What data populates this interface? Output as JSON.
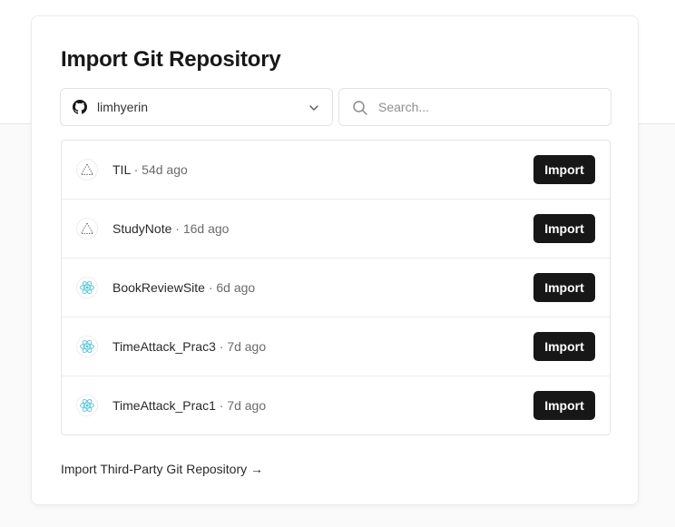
{
  "modal": {
    "title": "Import Git Repository",
    "account": {
      "name": "limhyerin",
      "icon": "github-icon"
    },
    "search": {
      "placeholder": "Search..."
    },
    "repos": [
      {
        "name": "TIL",
        "separator": " · ",
        "age": "54d ago",
        "icon": "vercel-triangle-icon",
        "button": "Import"
      },
      {
        "name": "StudyNote",
        "separator": " · ",
        "age": "16d ago",
        "icon": "vercel-triangle-icon",
        "button": "Import"
      },
      {
        "name": "BookReviewSite",
        "separator": " · ",
        "age": "6d ago",
        "icon": "react-icon",
        "button": "Import"
      },
      {
        "name": "TimeAttack_Prac3",
        "separator": " · ",
        "age": "7d ago",
        "icon": "react-icon",
        "button": "Import"
      },
      {
        "name": "TimeAttack_Prac1",
        "separator": " · ",
        "age": "7d ago",
        "icon": "react-icon",
        "button": "Import"
      }
    ],
    "third_party_link": "Import Third-Party Git Repository →"
  },
  "colors": {
    "button_bg": "#171717",
    "button_text": "#ffffff",
    "react_accent": "#58c4dc",
    "border": "#e6e6e6"
  }
}
